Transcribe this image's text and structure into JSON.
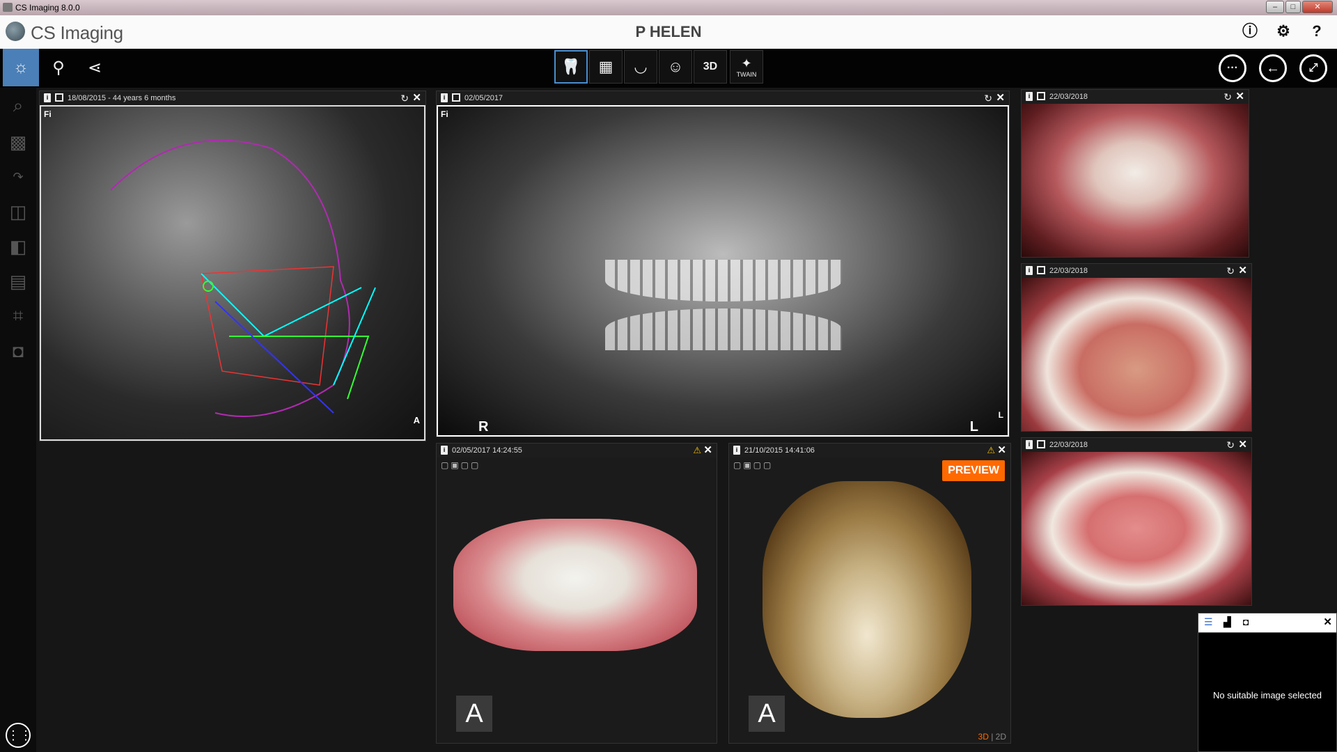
{
  "window": {
    "title": "CS Imaging 8.0.0",
    "buttons": [
      "–",
      "□",
      "✕"
    ]
  },
  "header": {
    "app_name": "CS Imaging",
    "patient_name": "P HELEN",
    "icons": [
      "info-icon",
      "gear-icon",
      "help-icon"
    ]
  },
  "toolbar": {
    "left_tools": [
      "brightness-icon",
      "probe-tool-icon",
      "share-icon"
    ],
    "acquisition": [
      "intraoral-xray",
      "intraoral-sensor",
      "panoramic",
      "cephalometric",
      "3d",
      "twain"
    ],
    "acquisition_3d_label": "3D",
    "twain_label": "TWAIN",
    "right_tools": [
      "more-icon",
      "back-icon",
      "fullscreen-icon"
    ]
  },
  "sidebar": {
    "tools": [
      "zoom-icon",
      "sharpen-icon",
      "rotate-icon",
      "compare-icon",
      "contrast-icon",
      "gradient-icon",
      "crop-icon",
      "tooth-icon"
    ],
    "apps_icon": "apps-grid-icon"
  },
  "panes": {
    "ceph": {
      "date": "18/08/2015 - 44 years 6 months",
      "corner_tl": "Fi",
      "corner_br": "A"
    },
    "pano": {
      "date": "02/05/2017",
      "corner_tl": "Fi",
      "label_r": "R",
      "label_l": "L",
      "corner_br": "L"
    },
    "photo1": {
      "date": "22/03/2018"
    },
    "photo2": {
      "date": "22/03/2018"
    },
    "photo3": {
      "date": "22/03/2018"
    },
    "scan": {
      "date": "02/05/2017 14:24:55",
      "badge": "A"
    },
    "cbct": {
      "date": "21/10/2015 14:41:06",
      "badge": "A",
      "preview": "PREVIEW",
      "mode_3d": "3D",
      "mode_sep": " | ",
      "mode_2d": "2D"
    }
  },
  "infopanel": {
    "message": "No suitable image selected"
  }
}
